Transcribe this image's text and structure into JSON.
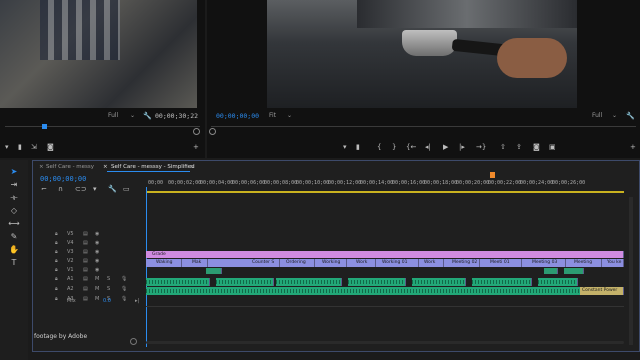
{
  "source_monitor": {
    "zoom": "Full",
    "timecode": "00;00;30;22"
  },
  "program_monitor": {
    "playhead_timecode": "00;00;00;00",
    "fit": "Fit",
    "zoom": "Full"
  },
  "transport": {
    "buttons": [
      "{",
      "}",
      "{←",
      "◁",
      "▶",
      "▷",
      "→}"
    ]
  },
  "timeline": {
    "tabs": [
      "Self Care - messy",
      "Self Care - messsy - Simplified"
    ],
    "current_timecode": "00;00;00;00",
    "ruler": [
      "00;00",
      "00;00;02;00",
      "00;00;04;00",
      "00;00;06;00",
      "00;00;08;00",
      "00;00;10;00",
      "00;00;12;00",
      "00;00;14;00",
      "00;00;16;00",
      "00;00;18;00",
      "00;00;20;00",
      "00;00;22;00",
      "00;00;24;00",
      "00;00;26;00"
    ],
    "video_tracks": [
      "V5",
      "V4",
      "V3",
      "V2",
      "V1"
    ],
    "audio_tracks": [
      "A1",
      "A2",
      "A3"
    ],
    "mix_label": "Mix",
    "mix_value": "0.0",
    "adjustment_clip": "Grade",
    "v1_clips": [
      "Waking",
      "Mak",
      "Counter S",
      "Ordering",
      "Working",
      "Work",
      "Working 01",
      "Work",
      "Meeting 02",
      "Meeti 01",
      "Meeting 03",
      "Meeting",
      "You ke"
    ],
    "audio_transition": "Constant Power"
  },
  "footer": {
    "credit": "footage by Adobe"
  },
  "colors": {
    "accent": "#2b8cf0",
    "video_clip": "#8c8fe0",
    "adjustment": "#d08be0",
    "audio_clip": "#22a878",
    "playhead": "#f08a2b"
  }
}
